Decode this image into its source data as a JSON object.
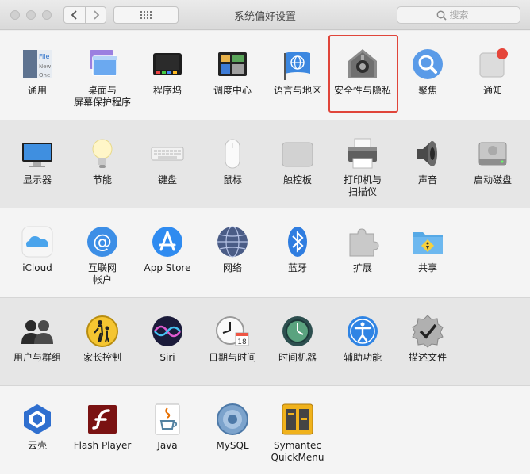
{
  "window": {
    "title": "系统偏好设置"
  },
  "search": {
    "placeholder": "搜索"
  },
  "rows": [
    [
      "通用",
      "桌面与\n屏幕保护程序",
      "程序坞",
      "调度中心",
      "语言与地区",
      "安全性与隐私",
      "聚焦",
      "通知"
    ],
    [
      "显示器",
      "节能",
      "键盘",
      "鼠标",
      "触控板",
      "打印机与\n扫描仪",
      "声音",
      "启动磁盘"
    ],
    [
      "iCloud",
      "互联网\n帐户",
      "App Store",
      "网络",
      "蓝牙",
      "扩展",
      "共享"
    ],
    [
      "用户与群组",
      "家长控制",
      "Siri",
      "日期与时间",
      "时间机器",
      "辅助功能",
      "描述文件"
    ],
    [
      "云壳",
      "Flash Player",
      "Java",
      "MySQL",
      "Symantec\nQuickMenu"
    ]
  ],
  "icon_text": {
    "general_file": "File",
    "general_new": "New",
    "general_one": "One",
    "calendar_day": "18"
  },
  "highlighted_item": "安全性与隐私",
  "colors": {
    "highlight": "#e0453a",
    "accent": "#2a7de1"
  }
}
